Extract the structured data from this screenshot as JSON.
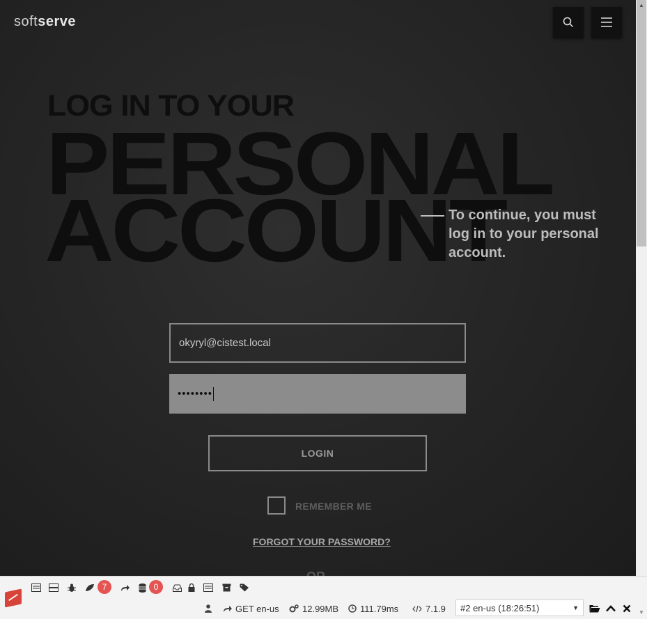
{
  "header": {
    "logo_light": "soft",
    "logo_bold": "serve",
    "search_icon": "search-icon",
    "menu_icon": "hamburger-menu-icon"
  },
  "hero": {
    "line1": "LOG IN TO YOUR",
    "line2": "PERSONAL",
    "line3": "ACCOUNT",
    "tagline": "To continue, you must log in to your personal account."
  },
  "form": {
    "email_value": "okyryl@cistest.local",
    "password_mask": "••••••••",
    "login_label": "LOGIN",
    "remember_label": "REMEMBER ME",
    "forgot_label": "FORGOT YOUR PASSWORD?",
    "or_label": "OR"
  },
  "toolbar": {
    "badge_logs": "7",
    "badge_db": "0",
    "request": "GET en-us",
    "memory": "12.99MB",
    "time": "111.79ms",
    "version": "7.1.9",
    "history_selected": "#2 en-us (18:26:51)"
  },
  "colors": {
    "page_bg": "#262626",
    "heading": "#0e0e0e",
    "tagline": "#bdbdbd",
    "password_bg": "#8c8c8c",
    "badge": "#e55353",
    "brand_red": "#d7443a"
  }
}
